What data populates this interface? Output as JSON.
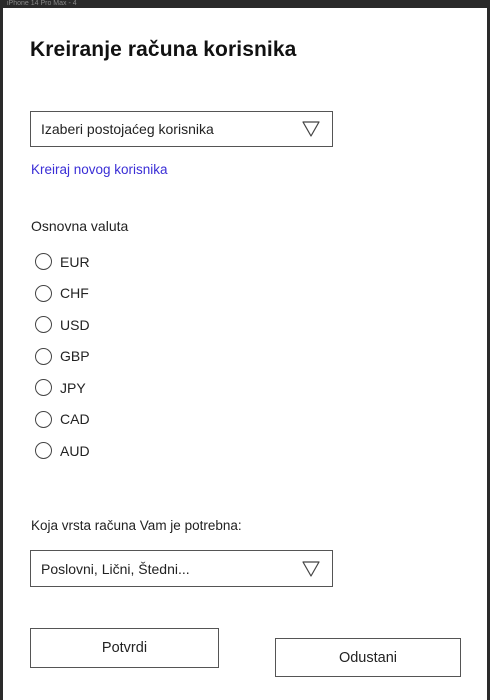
{
  "device": {
    "label": "iPhone 14 Pro Max - 4"
  },
  "form": {
    "title": "Kreiranje računa korisnika",
    "user_select": {
      "value": "Izaberi postojaćeg korisnika",
      "icon": "triangle-down-icon"
    },
    "create_user_link": "Kreiraj novog korisnika",
    "currency": {
      "label": "Osnovna valuta",
      "options": [
        {
          "label": "EUR",
          "selected": false
        },
        {
          "label": "CHF",
          "selected": false
        },
        {
          "label": "USD",
          "selected": false
        },
        {
          "label": "GBP",
          "selected": false
        },
        {
          "label": "JPY",
          "selected": false
        },
        {
          "label": "CAD",
          "selected": false
        },
        {
          "label": "AUD",
          "selected": false
        }
      ]
    },
    "account_type": {
      "label": "Koja vrsta računa Vam  je potrebna:",
      "value": "Poslovni, Lični, Štedni...",
      "icon": "triangle-down-icon"
    },
    "confirm_label": "Potvrdi",
    "cancel_label": "Odustani"
  },
  "colors": {
    "link": "#3a2ed6",
    "frame": "#2a2a2a",
    "background": "#ffffff"
  }
}
